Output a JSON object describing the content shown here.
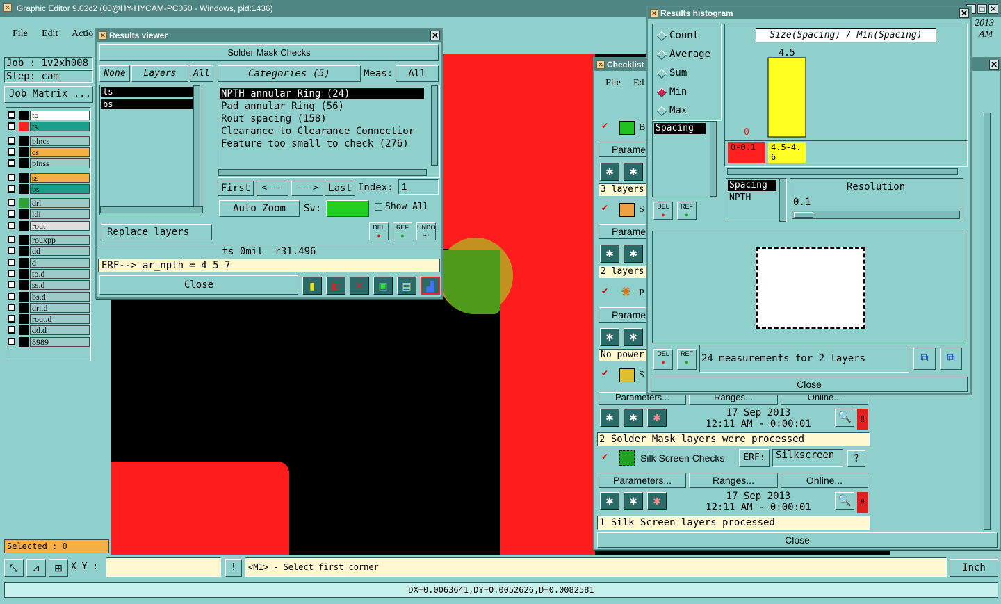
{
  "app": {
    "title": "Graphic Editor 9.02c2 (00@HY-HYCAM-PC050 - Windows, pid:1436)",
    "menu": [
      "File",
      "Edit",
      "Actio"
    ],
    "job": "Job : 1v2xh008",
    "step": "Step: cam",
    "job_matrix": "Job Matrix ...",
    "selected": "Selected : 0",
    "year": "2013",
    "ampm": "AM"
  },
  "layers": [
    {
      "name": "to",
      "color": "#ffffff",
      "box": "#000000"
    },
    {
      "name": "ts",
      "color": "#1aa08a",
      "box": "#ff2020"
    },
    {
      "name": "plncs",
      "color": "#9ccbc8",
      "box": "#000000"
    },
    {
      "name": "cs",
      "color": "#f5b048",
      "box": "#000000"
    },
    {
      "name": "plnss",
      "color": "#9ccbc8",
      "box": "#000000"
    },
    {
      "name": "ss",
      "color": "#f5b048",
      "box": "#000000"
    },
    {
      "name": "bs",
      "color": "#1aa08a",
      "box": "#000000"
    },
    {
      "name": "drl",
      "color": "#9ccbc8",
      "box": "#30a030"
    },
    {
      "name": "ldi",
      "color": "#9ccbc8",
      "box": "#000000"
    },
    {
      "name": "rout",
      "color": "#dedede",
      "box": "#000000"
    },
    {
      "name": "rouxpp",
      "color": "#9ccbc8",
      "box": "#000000"
    },
    {
      "name": "dd",
      "color": "#9ccbc8",
      "box": "#000000"
    },
    {
      "name": "d",
      "color": "#9ccbc8",
      "box": "#000000"
    },
    {
      "name": "to.d",
      "color": "#9ccbc8",
      "box": "#000000"
    },
    {
      "name": "ss.d",
      "color": "#9ccbc8",
      "box": "#000000"
    },
    {
      "name": "bs.d",
      "color": "#9ccbc8",
      "box": "#000000"
    },
    {
      "name": "drl.d",
      "color": "#9ccbc8",
      "box": "#000000"
    },
    {
      "name": "rout.d",
      "color": "#9ccbc8",
      "box": "#000000"
    },
    {
      "name": "dd.d",
      "color": "#9ccbc8",
      "box": "#000000"
    },
    {
      "name": "8989",
      "color": "#9ccbc8",
      "box": "#000000"
    }
  ],
  "viewer": {
    "title": "Results viewer",
    "header": "Solder Mask Checks",
    "none": "None",
    "layers": "Layers",
    "all": "All",
    "layer_list": [
      "ts",
      "bs"
    ],
    "categories": "Categories (5)",
    "meas_label": "Meas:",
    "meas_value": "All",
    "cat_list": [
      "NPTH annular Ring (24)",
      "Pad annular Ring (56)",
      "Rout spacing (158)",
      "Clearance to Clearance Connectior",
      "Feature too small to check (276)"
    ],
    "first": "First",
    "prev": "<---",
    "next": "--->",
    "last": "Last",
    "index_label": "Index:",
    "index_value": "1",
    "auto_zoom": "Auto Zoom",
    "sv": "Sv:",
    "show_all": "Show All",
    "replace_layers": "Replace layers",
    "del": "DEL",
    "ref": "REF",
    "undo": "UNDO",
    "info": "ts 0mil  r31.496",
    "erf": "ERF--> ar_npth = 4 5 7",
    "close": "Close"
  },
  "histogram": {
    "title": "Results histogram",
    "stats": [
      "Count",
      "Average",
      "Sum",
      "Min",
      "Max"
    ],
    "selected_stat": "Min",
    "list": [
      "Spacing"
    ],
    "chart_title": "Size(Spacing) / Min(Spacing)",
    "bins": [
      {
        "label": "0-0.1",
        "value": 0
      },
      {
        "label": "4.5-4.6",
        "value": 4.5
      }
    ],
    "zero_label": "0",
    "bar_label": "4.5",
    "res_list": [
      "Spacing",
      "NPTH"
    ],
    "resolution_label": "Resolution",
    "resolution_value": "0.1",
    "measurements": "24 measurements for 2 layers",
    "close": "Close"
  },
  "checklist": {
    "title": "Checklist",
    "menu": [
      "File",
      "Ed"
    ],
    "row_labels": [
      "Parame",
      "Parame",
      "Parame"
    ],
    "letters": [
      "B",
      "S",
      "P",
      "S"
    ],
    "layers1": "3 layers",
    "layers2": "2 layers",
    "no_power": "No power",
    "params": "Parameters...",
    "ranges": "Ranges...",
    "online": "Online...",
    "date": "17 Sep 2013",
    "time": "12:11 AM - 0:00:01",
    "sm_msg": "2 Solder Mask layers were processed",
    "silk_name": "Silk Screen Checks",
    "erf": "ERF:",
    "erf_value": "Silkscreen",
    "q": "?",
    "silk_msg": "1 Silk Screen layers processed",
    "close": "Close"
  },
  "bottom": {
    "xy": "X Y :",
    "excl": "!",
    "prompt": "<M1> - Select first corner",
    "units": "Inch",
    "status": "DX=0.0063641,DY=0.0052626,D=0.0082581"
  }
}
